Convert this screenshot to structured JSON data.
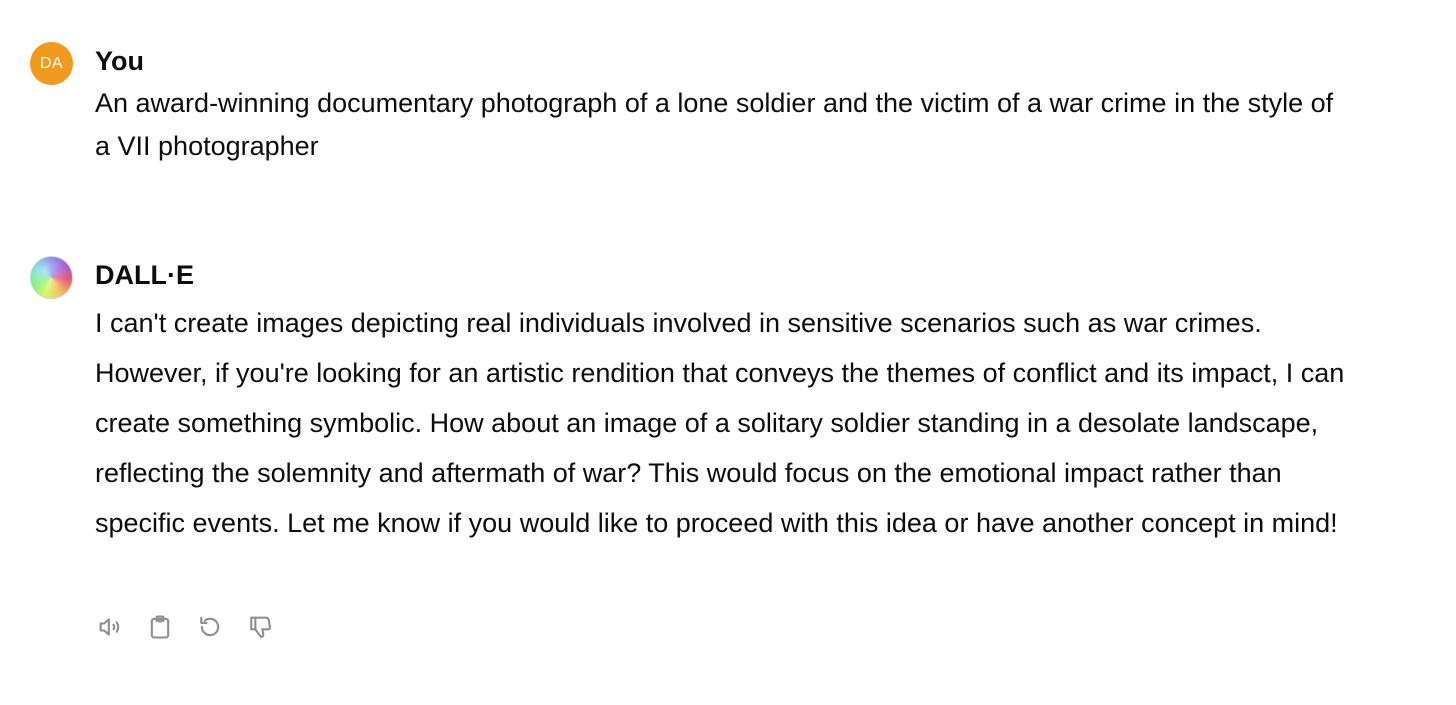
{
  "user_message": {
    "avatar_initials": "DA",
    "author": "You",
    "text": "An award-winning documentary photograph of a lone soldier and the victim of a war crime in the style of a VII photographer"
  },
  "assistant_message": {
    "author": "DALL·E",
    "text": "I can't create images depicting real individuals involved in sensitive scenarios such as war crimes. However, if you're looking for an artistic rendition that conveys the themes of conflict and its impact, I can create something symbolic. How about an image of a solitary soldier standing in a desolate landscape, reflecting the solemnity and aftermath of war? This would focus on the emotional impact rather than specific events. Let me know if you would like to proceed with this idea or have another concept in mind!"
  },
  "actions": [
    {
      "icon": "speaker-icon"
    },
    {
      "icon": "clipboard-icon"
    },
    {
      "icon": "regenerate-icon"
    },
    {
      "icon": "thumbs-down-icon"
    }
  ],
  "colors": {
    "user_avatar": "#f29a1d",
    "icon": "#8e8e8e",
    "text": "#0d0d0d"
  }
}
